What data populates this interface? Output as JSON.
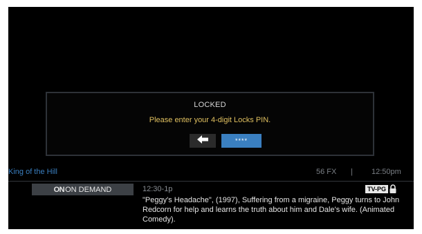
{
  "dialog": {
    "title": "LOCKED",
    "message": "Please enter your 4-digit Locks PIN.",
    "pin_value": "****",
    "back_icon": "left-arrow-icon"
  },
  "info_bar": {
    "show_title": "King of the Hill",
    "channel": "56 FX",
    "divider": "|",
    "clock": "12:50pm"
  },
  "program": {
    "on_demand_logo": "ON",
    "on_demand_label": "ON DEMAND",
    "time_range": "12:30-1p",
    "rating": "TV-PG",
    "lock_icon": "lock-icon",
    "description": "\"Peggy's Headache\", (1997), Suffering from a migraine, Peggy turns to John Redcorn for help and learns the truth about him and Dale's wife. (Animated Comedy)."
  },
  "colors": {
    "background": "#000000",
    "accent_blue": "#3a7fc0",
    "message_yellow": "#e0c060",
    "dim_gray": "#7a7f85"
  }
}
